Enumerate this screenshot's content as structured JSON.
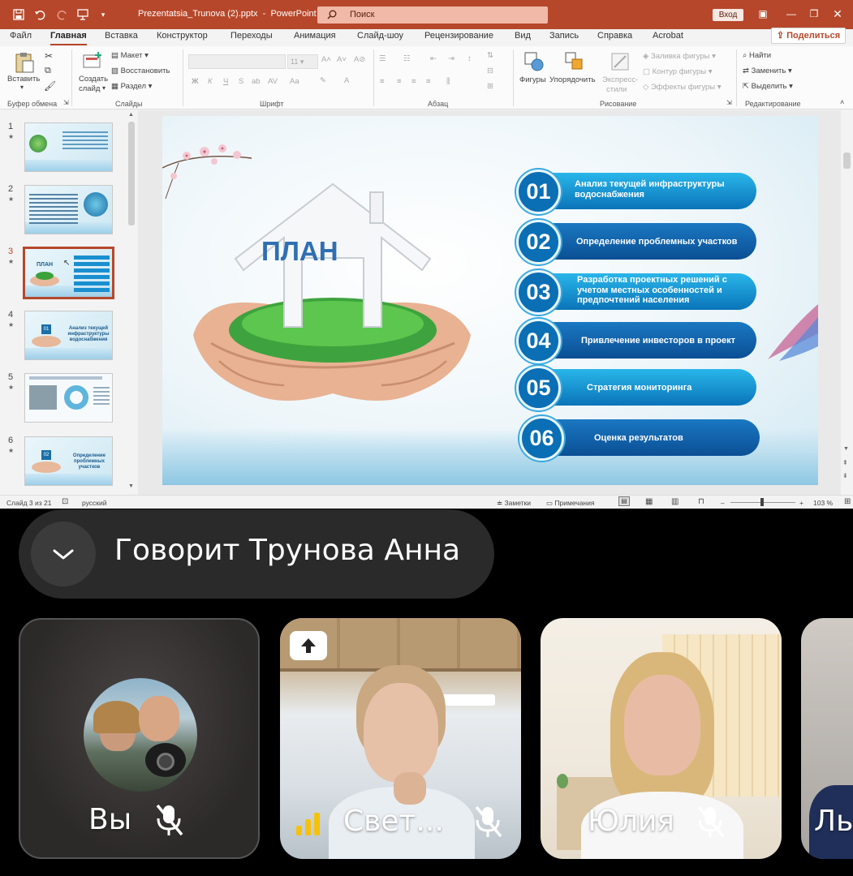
{
  "window": {
    "file_title": "Prezentatsia_Trunova (2).pptx",
    "app_sep": "  -  ",
    "app_name": "PowerPoint",
    "search_placeholder": "Поиск",
    "signin_label": "Вход",
    "share_label": "Поделиться"
  },
  "tabs": [
    "Файл",
    "Главная",
    "Вставка",
    "Конструктор",
    "Переходы",
    "Анимация",
    "Слайд-шоу",
    "Рецензирование",
    "Вид",
    "Запись",
    "Справка",
    "Acrobat"
  ],
  "ribbon": {
    "clipboard": {
      "paste": "Вставить",
      "group": "Буфер обмена"
    },
    "slides": {
      "new_slide_1": "Создать",
      "new_slide_2": "слайд",
      "layout": "Макет",
      "reset": "Восстановить",
      "section": "Раздел",
      "group": "Слайды"
    },
    "font": {
      "size": "11",
      "group": "Шрифт",
      "bold": "Ж",
      "italic": "К",
      "underline": "Ч",
      "strike": "S",
      "case": "Aa"
    },
    "paragraph": {
      "group": "Абзац"
    },
    "drawing": {
      "shapes": "Фигуры",
      "arrange": "Упорядочить",
      "quick_1": "Экспресс-",
      "quick_2": "стили",
      "fill": "Заливка фигуры",
      "outline": "Контур фигуры",
      "effects": "Эффекты фигуры",
      "group": "Рисование"
    },
    "editing": {
      "find": "Найти",
      "replace": "Заменить",
      "select": "Выделить",
      "group": "Редактирование"
    }
  },
  "thumbnails": [
    {
      "num": "1",
      "caption": ""
    },
    {
      "num": "2",
      "caption": ""
    },
    {
      "num": "3",
      "caption": "ПЛАН"
    },
    {
      "num": "4",
      "caption": "Анализ текущей инфраструктуры водоснабжения"
    },
    {
      "num": "5",
      "caption": ""
    },
    {
      "num": "6",
      "caption": "Определение проблемных участков"
    }
  ],
  "slide": {
    "house_label": "ПЛАН",
    "items": [
      {
        "num": "01",
        "text": "Анализ текущей инфраструктуры водоснабжения"
      },
      {
        "num": "02",
        "text": "Определение проблемных участков"
      },
      {
        "num": "03",
        "text": "Разработка проектных решений с учетом местных особенностей и предпочтений населения"
      },
      {
        "num": "04",
        "text": "Привлечение инвесторов в проект"
      },
      {
        "num": "05",
        "text": "Стратегия мониторинга"
      },
      {
        "num": "06",
        "text": "Оценка результатов"
      }
    ]
  },
  "status": {
    "slide_info": "Слайд 3 из 21",
    "language": "русский",
    "notes": "Заметки",
    "comments": "Примечания",
    "zoom_minus": "–",
    "zoom_plus": "+",
    "zoom": "103 %"
  },
  "call": {
    "speaker_text": "Говорит Трунова Анна",
    "participants": [
      {
        "name": "Вы"
      },
      {
        "name": "Свет..."
      },
      {
        "name": "Юлия"
      },
      {
        "name": "Ль"
      }
    ]
  },
  "colors": {
    "ppt_accent": "#b7472a",
    "slide_blue": "#0a74b9",
    "call_bg": "#000000"
  }
}
